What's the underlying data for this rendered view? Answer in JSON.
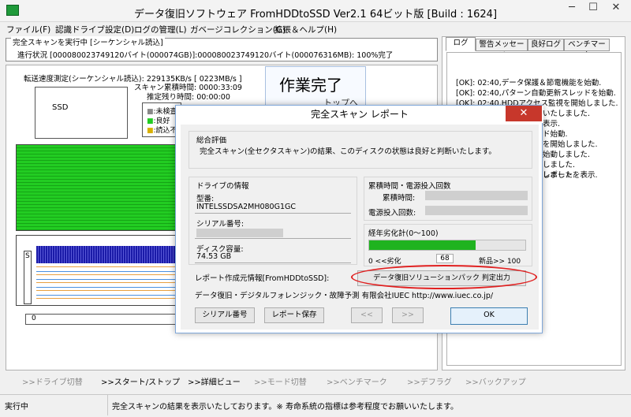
{
  "window": {
    "title": "データ復旧ソフトウェア FromHDDtoSSD Ver2.1 64ビット版 [Build : 1624]",
    "minimize": "─",
    "maximize": "☐",
    "close": "✕"
  },
  "menu": [
    "ファイル(F)",
    "認識ドライブ設定(D)",
    "ログの管理(L)",
    "ガベージコレクション(G)",
    "拡張＆ヘルプ(H)"
  ],
  "scan": {
    "group_title": "完全スキャンを実行中 [シーケンシャル読込]",
    "progress": "進行状況 [000080023749120バイト(000074GB)]:000080023749120バイト(000076316MB): 100%完了",
    "speed": "転送速度測定(シーケンシャル読込): 229135KB/s [ 0223MB/s ]",
    "elapsed": "スキャン累積時間: 0000:33:09",
    "remaining": "推定残り時間: 00:00:00",
    "drive_label": "SSD",
    "done_label": "作業完了",
    "done_sub": "トップへ",
    "legend": [
      ":未検査",
      ":良好",
      ":読込不"
    ],
    "s_label": "S",
    "zero_label": "0"
  },
  "tabs": [
    "ログ",
    "警告メッセージ",
    "良好ログ",
    "ベンチマーク"
  ],
  "log": [
    "[OK]: 02:40,データ保護＆節電機能を始動.",
    "[OK]: 02:40,パターン自動更新スレッドを始動.",
    "[OK]: 02:40,HDDアクセス監視を開始しました.",
    "いたしました.",
    "表示.",
    "ド始動.",
    "を開始しました.",
    "始動しました.",
    "しました.",
    "しました.",
    "レポートを表示."
  ],
  "dialog": {
    "title": "完全スキャン レポート",
    "close": "✕",
    "eval_title": "総合評価",
    "eval_text": "完全スキャン(全セクタスキャン)の結果、このディスクの状態は良好と判断いたします。",
    "drive_info_title": "ドライブの情報",
    "model_label": "型番:",
    "model_value": "INTELSSDSA2MH080G1GC",
    "serial_label": "シリアル番号:",
    "capacity_label": "ディスク容量:",
    "capacity_value": "74.53 GB",
    "power_title": "累積時間・電源投入回数",
    "hours_label": "累積時間:",
    "count_label": "電源投入回数:",
    "wear_title": "経年劣化計(0～100)",
    "wear_value": 68,
    "wear_left": "0 <<劣化",
    "wear_right": "新品>> 100",
    "wear_display": "68",
    "source_label": "レポート作成元情報[FromHDDtoSSD]:",
    "source_button": "データ復旧ソリューションパック 判定出力",
    "company": "データ復旧・デジタルフォレンジック・故障予測 有限会社IUEC http://www.iuec.co.jp/",
    "btn_serial": "シリアル番号",
    "btn_save": "レポート保存",
    "btn_prev": "<<",
    "btn_next": ">>",
    "btn_ok": "OK"
  },
  "nav": [
    ">>ドライブ切替",
    ">>スタート/ストップ",
    ">>詳細ビュー",
    ">>モード切替",
    ">>ベンチマーク",
    ">>デフラグ",
    ">>バックアップ"
  ],
  "status": {
    "left": "実行中",
    "main": "完全スキャンの結果を表示いたしております。※ 寿命系統の指標は参考程度でお願いいたします。"
  },
  "colors": {
    "good": "#22cc22",
    "wear": "#1fb31f",
    "highlight": "#e02020",
    "chart_blue": "#1a1aa8"
  }
}
